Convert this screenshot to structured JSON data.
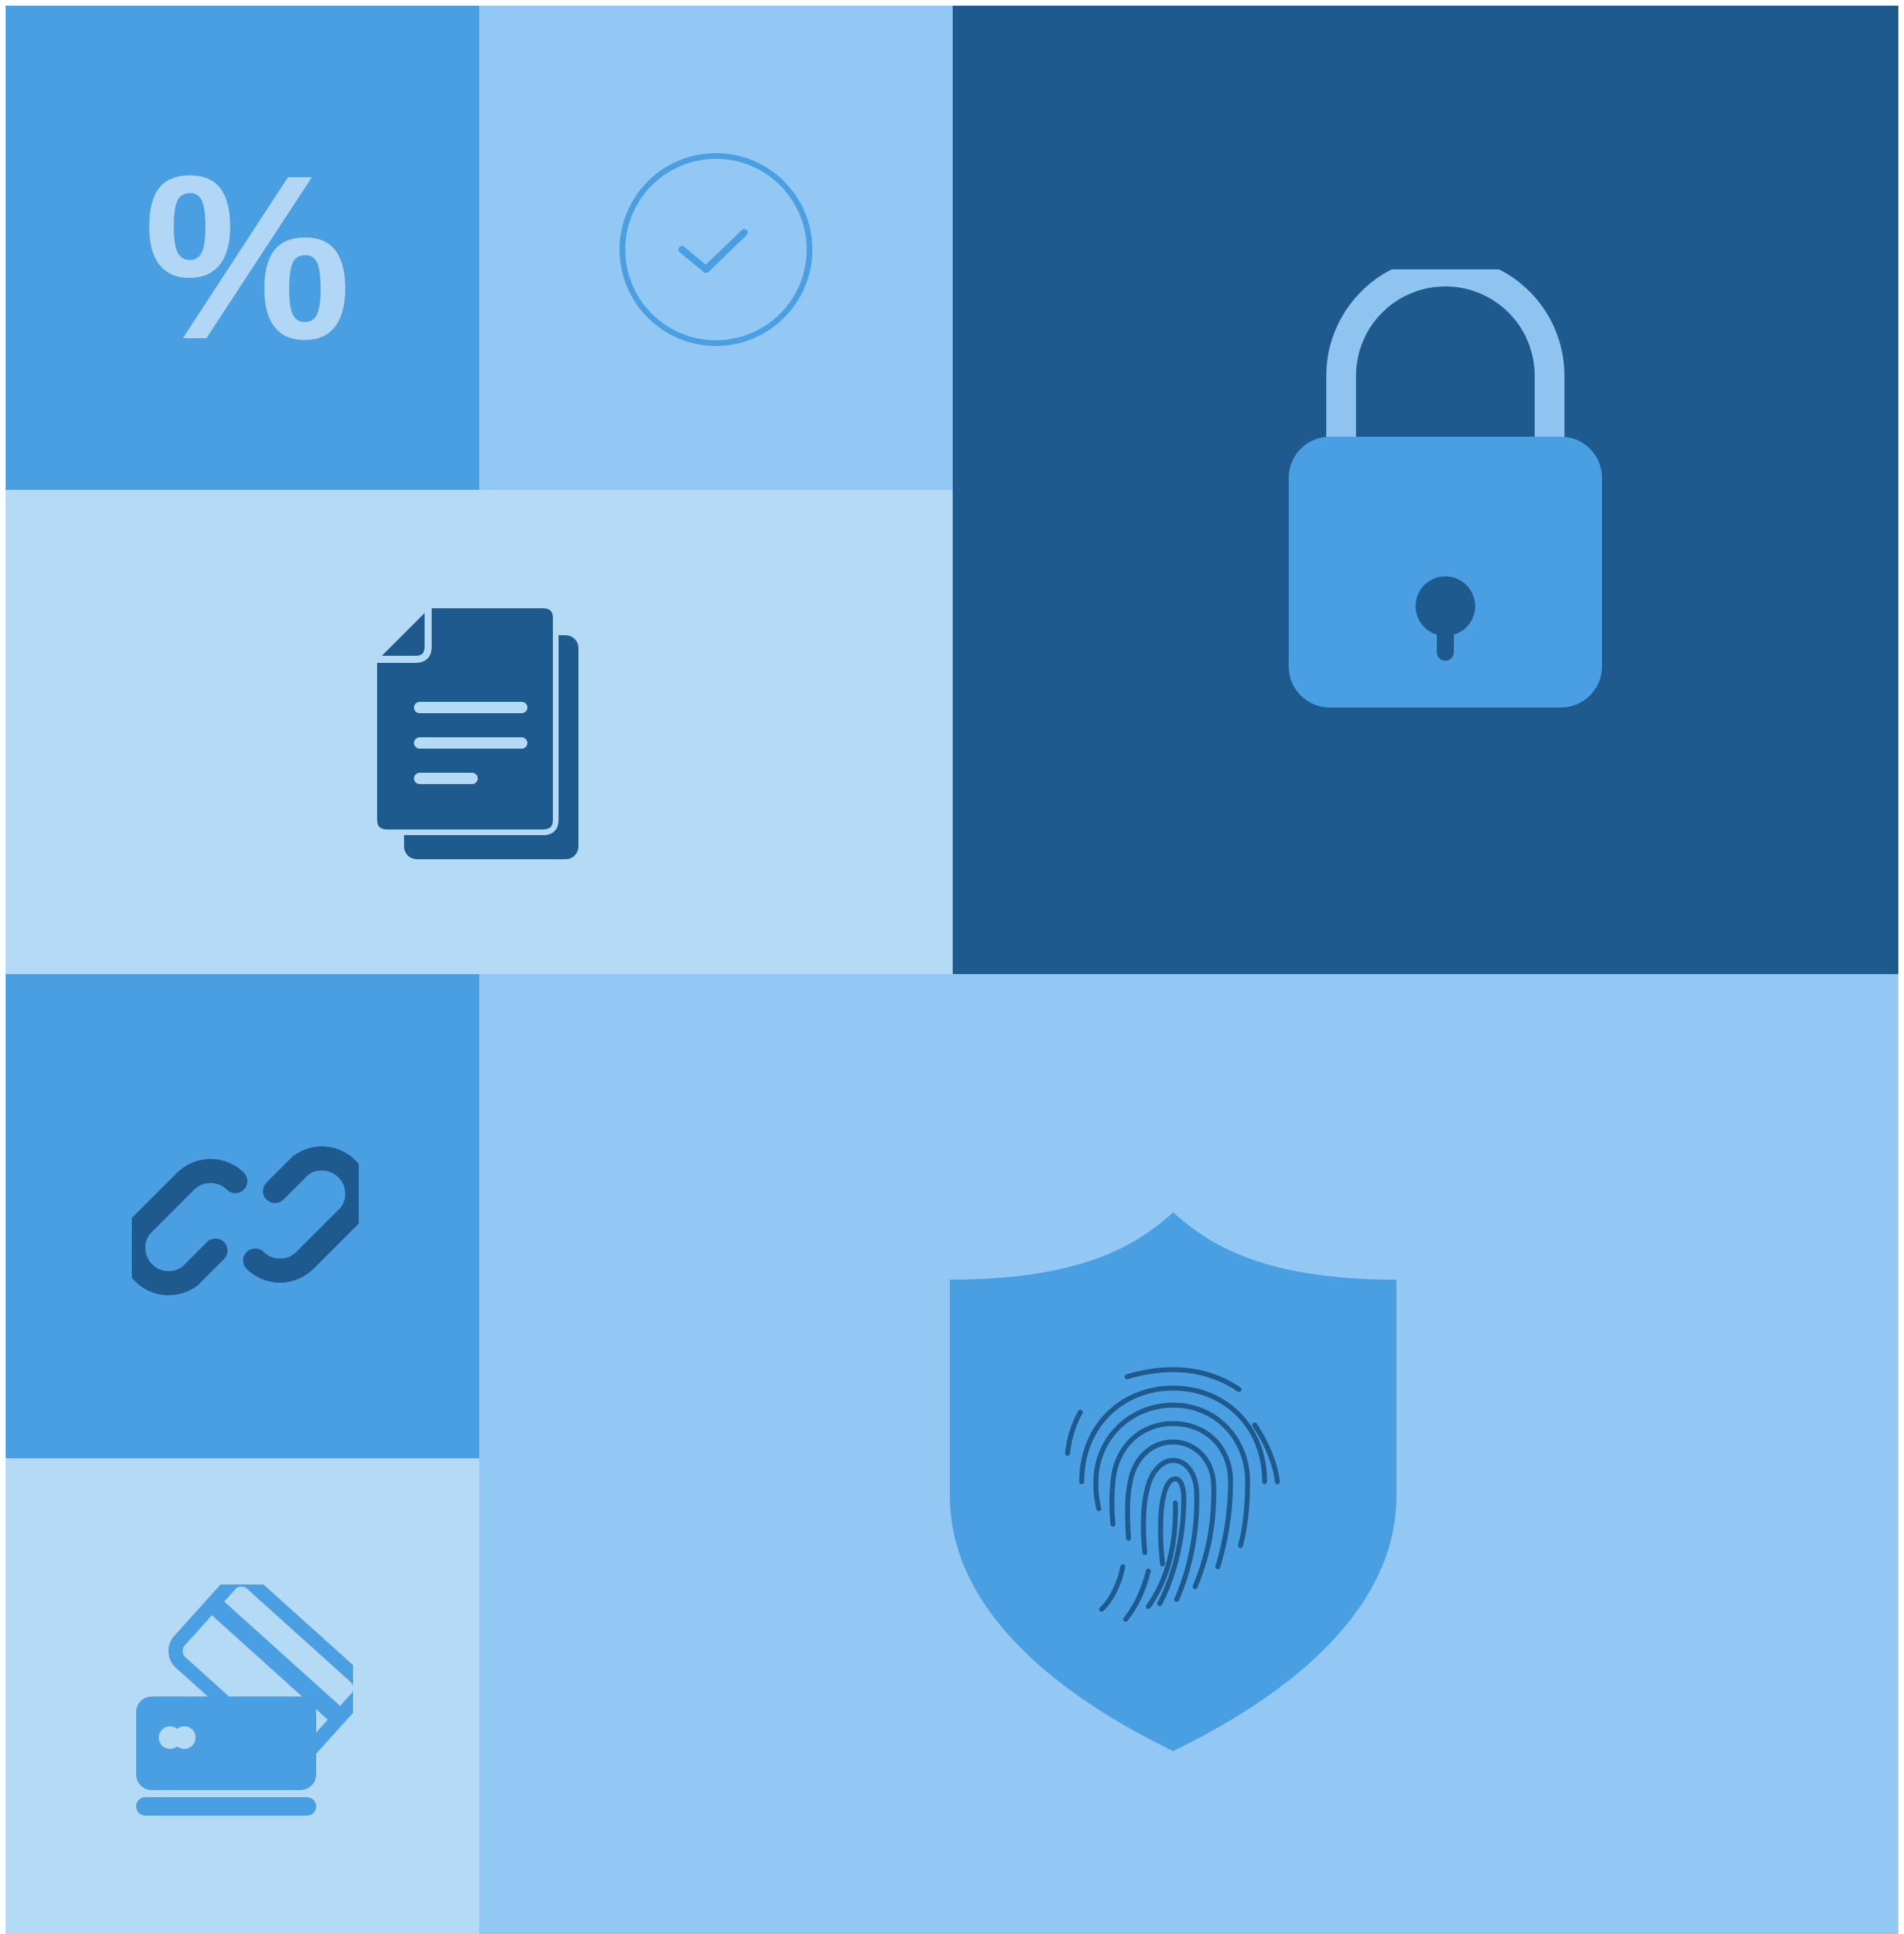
{
  "colors": {
    "mid_blue": "#4a9fe2",
    "light_blue": "#92c8f3",
    "pale_blue": "#b5daf6",
    "dark_blue": "#1f5a8e",
    "percent_fill": "#b2d7f6",
    "lock_shackle": "#8fc4f0",
    "lock_body": "#4a9fe2",
    "lock_keyhole": "#1f5a8e",
    "document_fill": "#1f5a8e",
    "chain_fill": "#1f5a8e",
    "card_fill": "#4a9fe2",
    "shield_fill": "#4a9fe2",
    "fingerprint_stroke": "#1f5a8e",
    "check_stroke": "#4a9fe2"
  },
  "tiles": {
    "percent": {
      "icon": "percent-icon",
      "glyph": "%"
    },
    "checkmark": {
      "icon": "check-circle-icon"
    },
    "lock": {
      "icon": "padlock-icon"
    },
    "document": {
      "icon": "document-stack-icon"
    },
    "link": {
      "icon": "chain-link-icon"
    },
    "shield": {
      "icon": "fingerprint-shield-icon"
    },
    "cards": {
      "icon": "credit-cards-icon"
    }
  }
}
